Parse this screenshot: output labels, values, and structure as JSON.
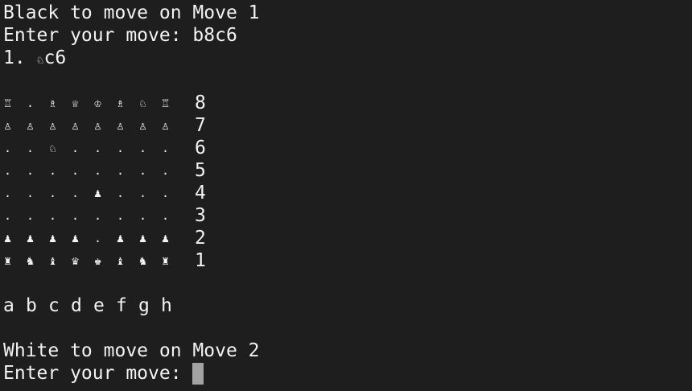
{
  "colors": {
    "background": "#1e1e1e",
    "text": "#f2f2f2",
    "cursor": "#a3a3a3"
  },
  "header": {
    "line1": "Black to move on Move 1",
    "prompt1": "Enter your move: ",
    "input1": "b8c6",
    "move_number": "1. ",
    "move_piece": "♘",
    "move_square": "c6"
  },
  "board": {
    "rows": [
      {
        "cells": [
          "♖",
          ".",
          "♗",
          "♕",
          "♔",
          "♗",
          "♘",
          "♖"
        ],
        "rank": "8"
      },
      {
        "cells": [
          "♙",
          "♙",
          "♙",
          "♙",
          "♙",
          "♙",
          "♙",
          "♙"
        ],
        "rank": "7"
      },
      {
        "cells": [
          ".",
          ".",
          "♘",
          ".",
          ".",
          ".",
          ".",
          "."
        ],
        "rank": "6"
      },
      {
        "cells": [
          ".",
          ".",
          ".",
          ".",
          ".",
          ".",
          ".",
          "."
        ],
        "rank": "5"
      },
      {
        "cells": [
          ".",
          ".",
          ".",
          ".",
          "♟",
          ".",
          ".",
          "."
        ],
        "rank": "4"
      },
      {
        "cells": [
          ".",
          ".",
          ".",
          ".",
          ".",
          ".",
          ".",
          "."
        ],
        "rank": "3"
      },
      {
        "cells": [
          "♟",
          "♟",
          "♟",
          "♟",
          ".",
          "♟",
          "♟",
          "♟"
        ],
        "rank": "2"
      },
      {
        "cells": [
          "♜",
          "♞",
          "♝",
          "♛",
          "♚",
          "♝",
          "♞",
          "♜"
        ],
        "rank": "1"
      }
    ],
    "files": [
      "a",
      "b",
      "c",
      "d",
      "e",
      "f",
      "g",
      "h"
    ]
  },
  "footer": {
    "line1": "White to move on Move 2",
    "prompt2": "Enter your move: ",
    "input2": ""
  }
}
